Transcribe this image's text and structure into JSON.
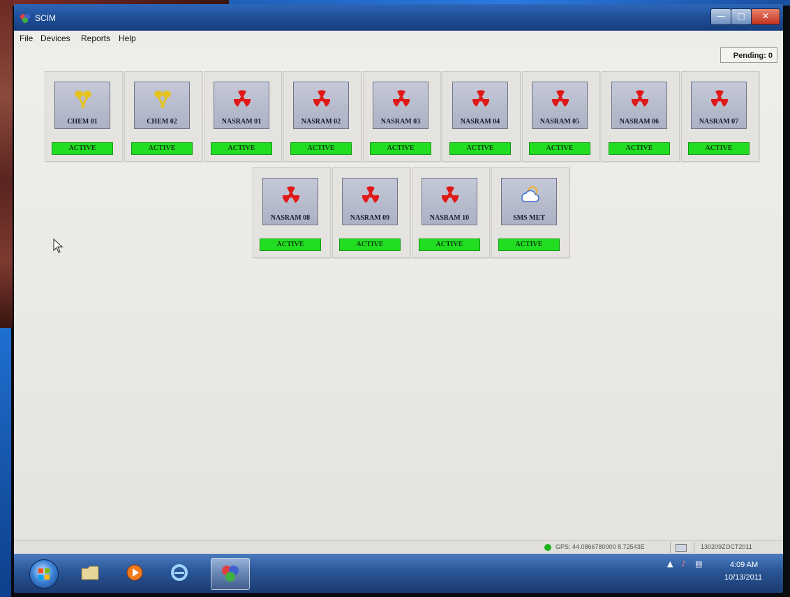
{
  "window": {
    "title": "SCIM"
  },
  "menu": {
    "items": [
      "File",
      "Devices",
      "Reports",
      "Help"
    ]
  },
  "pending": "Pending: 0",
  "colors": {
    "status_active": "#22dd22",
    "chem_icon": "#e6c21f",
    "rad_icon": "#e01818"
  },
  "devices_row1": [
    {
      "label": "CHEM 01",
      "status": "ACTIVE",
      "icon": "chem-sensor-icon"
    },
    {
      "label": "CHEM 02",
      "status": "ACTIVE",
      "icon": "chem-sensor-icon"
    },
    {
      "label": "NASRAM 01",
      "status": "ACTIVE",
      "icon": "radiation-icon"
    },
    {
      "label": "NASRAM 02",
      "status": "ACTIVE",
      "icon": "radiation-icon"
    },
    {
      "label": "NASRAM 03",
      "status": "ACTIVE",
      "icon": "radiation-icon"
    },
    {
      "label": "NASRAM 04",
      "status": "ACTIVE",
      "icon": "radiation-icon"
    },
    {
      "label": "NASRAM 05",
      "status": "ACTIVE",
      "icon": "radiation-icon"
    },
    {
      "label": "NASRAM 06",
      "status": "ACTIVE",
      "icon": "radiation-icon"
    },
    {
      "label": "NASRAM 07",
      "status": "ACTIVE",
      "icon": "radiation-icon"
    }
  ],
  "devices_row2": [
    {
      "label": "NASRAM 08",
      "status": "ACTIVE",
      "icon": "radiation-icon"
    },
    {
      "label": "NASRAM 09",
      "status": "ACTIVE",
      "icon": "radiation-icon"
    },
    {
      "label": "NASRAM 10",
      "status": "ACTIVE",
      "icon": "radiation-icon"
    },
    {
      "label": "SMS MET",
      "status": "ACTIVE",
      "icon": "weather-icon"
    }
  ],
  "statusbar": {
    "gps": "GPS: 44.0866780000 8.72543E",
    "dtg": "130209ZOCT2011"
  },
  "taskbar": {
    "time": "4:09 AM",
    "date": "10/13/2011"
  }
}
